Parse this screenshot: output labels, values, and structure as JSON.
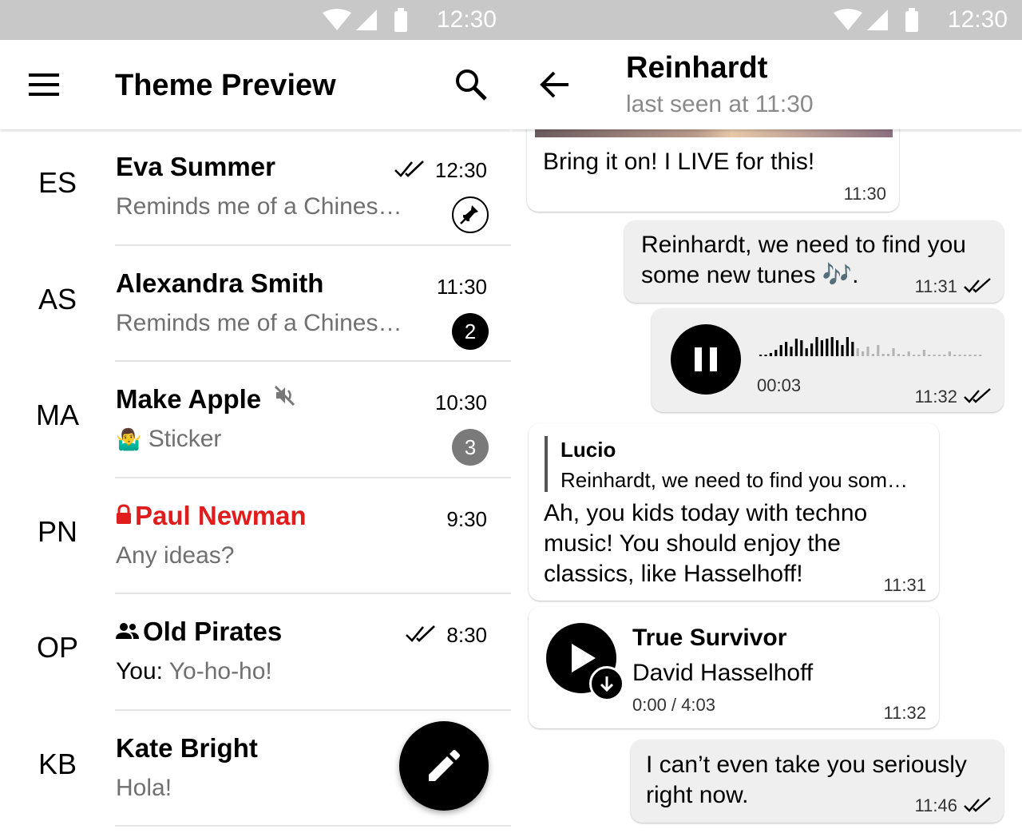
{
  "status_bar": {
    "time": "12:30"
  },
  "chat_list": {
    "title": "Theme Preview",
    "chats": [
      {
        "initials": "ES",
        "name": "Eva Summer",
        "time": "12:30",
        "preview": "Reminds me of a Chines…",
        "read_checks": true,
        "pinned": true
      },
      {
        "initials": "AS",
        "name": "Alexandra Smith",
        "time": "11:30",
        "preview": "Reminds me of a Chines…",
        "unread": "2"
      },
      {
        "initials": "MA",
        "name": "Make Apple",
        "time": "10:30",
        "preview": "Sticker",
        "preview_emoji": "🤷‍♂️",
        "muted": true,
        "unread": "3"
      },
      {
        "initials": "PN",
        "name": "Paul Newman",
        "time": "9:30",
        "preview": "Any ideas?",
        "secret": true,
        "name_color": "#e01c1c"
      },
      {
        "initials": "OP",
        "name": "Old Pirates",
        "time": "8:30",
        "preview_prefix": "You:",
        "preview": "Yo-ho-ho!",
        "group": true,
        "read_checks": true
      },
      {
        "initials": "KB",
        "name": "Kate Bright",
        "preview": "Hola!"
      }
    ]
  },
  "conversation": {
    "name": "Reinhardt",
    "status": "last seen at 11:30",
    "messages": {
      "m1": {
        "text": "Bring it on! I LIVE for this!",
        "time": "11:30"
      },
      "m2": {
        "line1": "Reinhardt, we need to find you",
        "line2": "some new tunes 🎶.",
        "time": "11:31"
      },
      "m3": {
        "duration": "00:03",
        "time": "11:32"
      },
      "m4": {
        "reply_author": "Lucio",
        "reply_text": "Reinhardt, we need to find you som…",
        "line1": "Ah, you kids today with techno",
        "line2": "music! You should enjoy the",
        "line3": "classics, like Hasselhoff!",
        "time": "11:31"
      },
      "m5": {
        "track_title": "True Survivor",
        "track_artist": "David Hasselhoff",
        "track_progress": "0:00 / 4:03",
        "time": "11:32"
      },
      "m6": {
        "line1": "I can’t even take you seriously",
        "line2": "right now.",
        "time": "11:46"
      }
    }
  },
  "colors": {
    "statusbar": "#c8c8c8",
    "accent": "#000000",
    "secret_chat": "#e01c1c",
    "outgoing_bubble": "#efefef"
  },
  "icons": [
    "menu-icon",
    "search-icon",
    "pin-icon",
    "mute-icon",
    "lock-icon",
    "group-icon",
    "double-check-icon",
    "pencil-icon",
    "back-arrow-icon",
    "pause-icon",
    "play-icon",
    "download-icon"
  ]
}
